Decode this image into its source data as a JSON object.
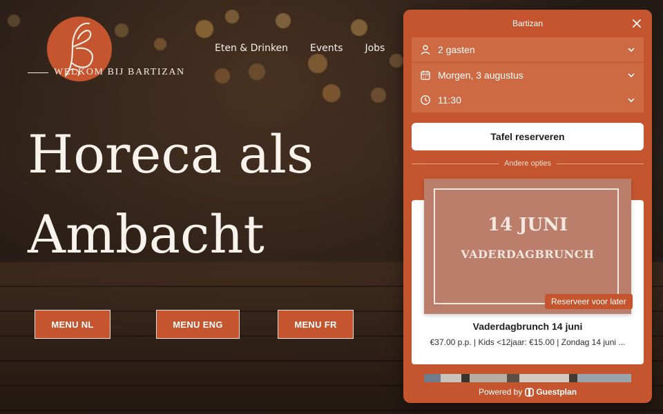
{
  "hero": {
    "tagline": "WELKOM BIJ BARTIZAN",
    "headline_line1": "Horeca als",
    "headline_line2": "Ambacht"
  },
  "nav": {
    "items": [
      "Eten & Drinken",
      "Events",
      "Jobs"
    ]
  },
  "menu_buttons": [
    "MENU NL",
    "MENU ENG",
    "MENU FR"
  ],
  "widget": {
    "title": "Bartizan",
    "guests": "2 gasten",
    "date": "Morgen, 3 augustus",
    "time": "11:30",
    "reserve_label": "Tafel reserveren",
    "other_options": "Andere opties",
    "event": {
      "image_date": "14 JUNI",
      "image_name": "VADERDAGBRUNCH",
      "later_badge": "Reserveer voor later",
      "title": "Vaderdagbrunch 14 juni",
      "description": "€37.00 p.p. | Kids <12jaar: €15.00 | Zondag 14 juni ..."
    },
    "powered_by": "Powered by",
    "brand": "Guestplan"
  },
  "colors": {
    "accent": "#c4552e",
    "field": "#cd6a44"
  }
}
